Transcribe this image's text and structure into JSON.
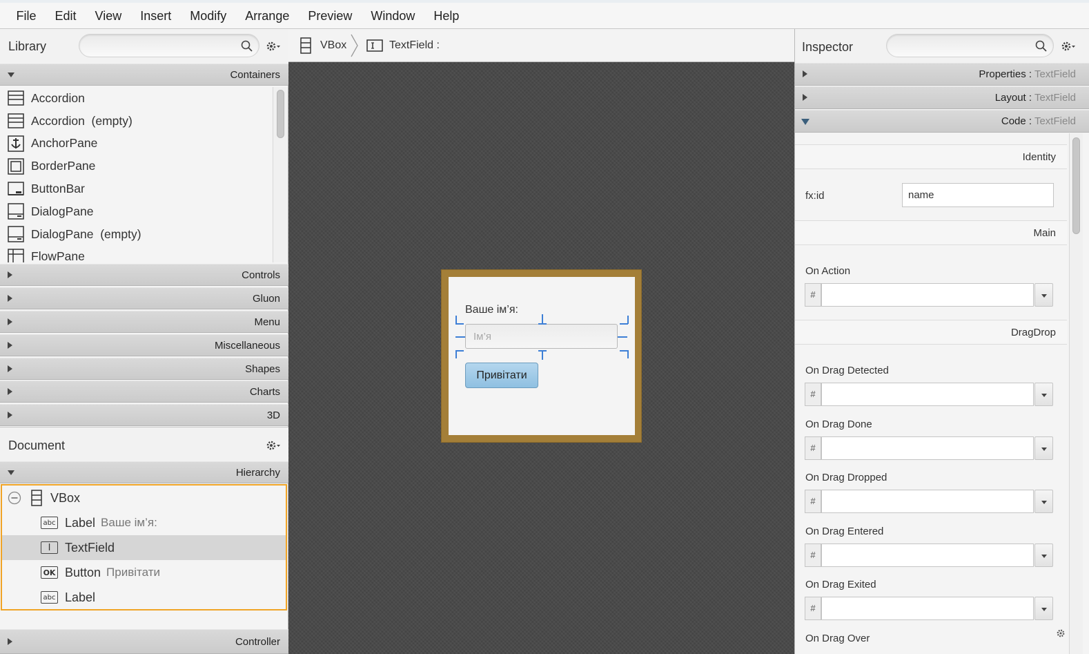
{
  "menu": [
    "File",
    "Edit",
    "View",
    "Insert",
    "Modify",
    "Arrange",
    "Preview",
    "Window",
    "Help"
  ],
  "library": {
    "title": "Library",
    "search_placeholder": "",
    "open_section": "Containers",
    "items": [
      "Accordion",
      "Accordion  (empty)",
      "AnchorPane",
      "BorderPane",
      "ButtonBar",
      "DialogPane",
      "DialogPane  (empty)",
      "FlowPane"
    ],
    "sections": [
      "Controls",
      "Gluon",
      "Menu",
      "Miscellaneous",
      "Shapes",
      "Charts",
      "3D"
    ]
  },
  "document": {
    "title": "Document",
    "hierarchy_label": "Hierarchy",
    "controller_label": "Controller",
    "tree": [
      {
        "name": "VBox",
        "sub": ""
      },
      {
        "name": "Label",
        "sub": "Ваше ім’я:"
      },
      {
        "name": "TextField",
        "sub": ""
      },
      {
        "name": "Button",
        "sub": "Привітати"
      },
      {
        "name": "Label",
        "sub": ""
      }
    ]
  },
  "breadcrumb": {
    "root": "VBox",
    "current": "TextField :"
  },
  "form": {
    "label": "Ваше ім’я:",
    "textfield_prompt": "Ім’я",
    "button": "Привітати"
  },
  "inspector": {
    "title": "Inspector",
    "search_placeholder": "",
    "sections": [
      {
        "label": "Properties",
        "target": "TextField"
      },
      {
        "label": "Layout",
        "target": "TextField"
      },
      {
        "label": "Code",
        "target": "TextField"
      }
    ],
    "separator": " : ",
    "identity_header": "Identity",
    "fxid_label": "fx:id",
    "fxid_value": "name",
    "main_header": "Main",
    "on_action_label": "On Action",
    "dragdrop_header": "DragDrop",
    "hash": "#",
    "drag_handlers": [
      "On Drag Detected",
      "On Drag Done",
      "On Drag Dropped",
      "On Drag Entered",
      "On Drag Exited"
    ],
    "last_visible_handler": "On Drag Over"
  },
  "colors": {
    "selection_border": "#f0a426",
    "frame": "#a47f38",
    "canvas": "#4a4a4a",
    "button": "#9fcae6",
    "handle": "#3d7fd6"
  }
}
